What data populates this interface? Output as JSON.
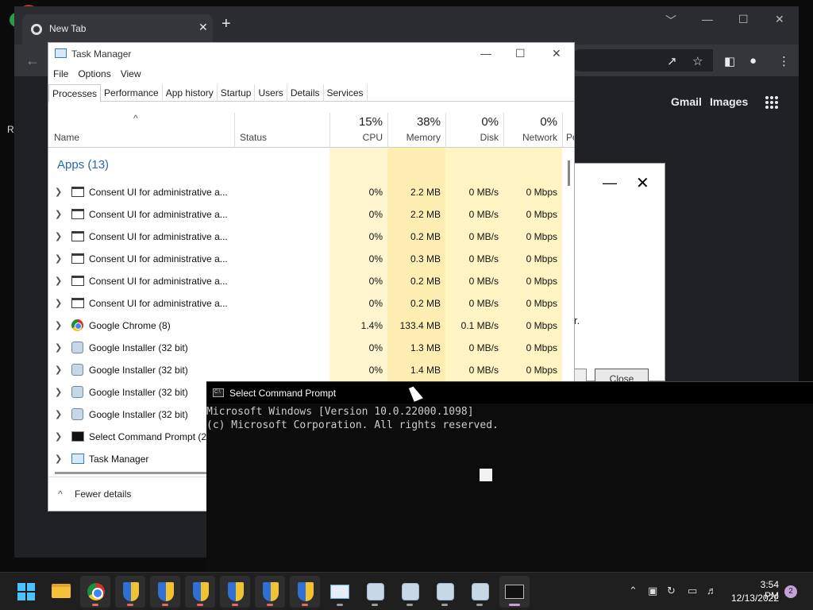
{
  "desktop": {
    "partial_label": "R"
  },
  "chrome": {
    "tab_title": "New Tab",
    "close_tab": "✕",
    "new_tab": "+",
    "window_controls": [
      "﹀",
      "—",
      "☐",
      "✕"
    ],
    "links": [
      "Gmail",
      "Images"
    ],
    "icons": [
      "back-arrow-icon",
      "share-icon",
      "star-icon",
      "side-panel-icon",
      "profile-icon",
      "menu-dots-icon",
      "apps-grid-icon"
    ]
  },
  "dialog": {
    "minimize": "—",
    "close": "✕",
    "partial_text": "r.",
    "button_label": "Close"
  },
  "task_manager": {
    "title": "Task Manager",
    "window_controls": [
      "—",
      "☐",
      "✕"
    ],
    "menu": [
      "File",
      "Options",
      "View"
    ],
    "tabs": [
      "Processes",
      "Performance",
      "App history",
      "Startup",
      "Users",
      "Details",
      "Services"
    ],
    "active_tab": "Processes",
    "sort_arrow": "^",
    "columns": {
      "name": "Name",
      "status": "Status",
      "cpu": {
        "pct": "15%",
        "label": "CPU"
      },
      "memory": {
        "pct": "38%",
        "label": "Memory"
      },
      "disk": {
        "pct": "0%",
        "label": "Disk"
      },
      "network": {
        "pct": "0%",
        "label": "Network"
      },
      "power_partial": "Po"
    },
    "group": "Apps (13)",
    "rows": [
      {
        "name": "Consent UI for administrative a...",
        "icon": "window",
        "cpu": "0%",
        "memory": "2.2 MB",
        "disk": "0 MB/s",
        "network": "0 Mbps"
      },
      {
        "name": "Consent UI for administrative a...",
        "icon": "window",
        "cpu": "0%",
        "memory": "2.2 MB",
        "disk": "0 MB/s",
        "network": "0 Mbps"
      },
      {
        "name": "Consent UI for administrative a...",
        "icon": "window",
        "cpu": "0%",
        "memory": "0.2 MB",
        "disk": "0 MB/s",
        "network": "0 Mbps"
      },
      {
        "name": "Consent UI for administrative a...",
        "icon": "window",
        "cpu": "0%",
        "memory": "0.3 MB",
        "disk": "0 MB/s",
        "network": "0 Mbps"
      },
      {
        "name": "Consent UI for administrative a...",
        "icon": "window",
        "cpu": "0%",
        "memory": "0.2 MB",
        "disk": "0 MB/s",
        "network": "0 Mbps"
      },
      {
        "name": "Consent UI for administrative a...",
        "icon": "window",
        "cpu": "0%",
        "memory": "0.2 MB",
        "disk": "0 MB/s",
        "network": "0 Mbps"
      },
      {
        "name": "Google Chrome (8)",
        "icon": "chrome",
        "cpu": "1.4%",
        "memory": "133.4 MB",
        "disk": "0.1 MB/s",
        "network": "0 Mbps"
      },
      {
        "name": "Google Installer (32 bit)",
        "icon": "installer",
        "cpu": "0%",
        "memory": "1.3 MB",
        "disk": "0 MB/s",
        "network": "0 Mbps"
      },
      {
        "name": "Google Installer (32 bit)",
        "icon": "installer",
        "cpu": "0%",
        "memory": "1.4 MB",
        "disk": "0 MB/s",
        "network": "0 Mbps"
      },
      {
        "name": "Google Installer (32 bit)",
        "icon": "installer",
        "cpu": "",
        "memory": "",
        "disk": "",
        "network": ""
      },
      {
        "name": "Google Installer (32 bit)",
        "icon": "installer",
        "cpu": "",
        "memory": "",
        "disk": "",
        "network": ""
      },
      {
        "name": "Select Command Prompt (2)",
        "icon": "cmd",
        "cpu": "",
        "memory": "",
        "disk": "",
        "network": ""
      },
      {
        "name": "Task Manager",
        "icon": "tmicon",
        "cpu": "",
        "memory": "",
        "disk": "",
        "network": ""
      }
    ],
    "footer": "Fewer details",
    "footer_arrow": "^"
  },
  "cmd": {
    "title": "Select Command Prompt",
    "icon_text": "C:\\",
    "lines": [
      "Microsoft Windows [Version 10.0.22000.1098]",
      "(c) Microsoft Corporation. All rights reserved."
    ]
  },
  "taskbar": {
    "apps": [
      "start-icon",
      "file-explorer-icon",
      "chrome-icon",
      "uac-shield-icon",
      "uac-shield-icon",
      "uac-shield-icon",
      "uac-shield-icon",
      "uac-shield-icon",
      "uac-shield-icon",
      "task-manager-icon",
      "google-installer-icon",
      "google-installer-icon",
      "google-installer-icon",
      "google-installer-icon",
      "command-prompt-icon"
    ],
    "tray_icons": [
      "chevron-up-icon",
      "network-icon",
      "sync-icon",
      "display-icon",
      "volume-icon"
    ],
    "time": "3:54 PM",
    "date": "12/13/2022",
    "notification_count": "2"
  },
  "colors": {
    "heat": "#fff4c4",
    "heat_strong": "#ffeeb0",
    "link_blue": "#2a66b8",
    "taskbar": "#1f1f1f"
  }
}
